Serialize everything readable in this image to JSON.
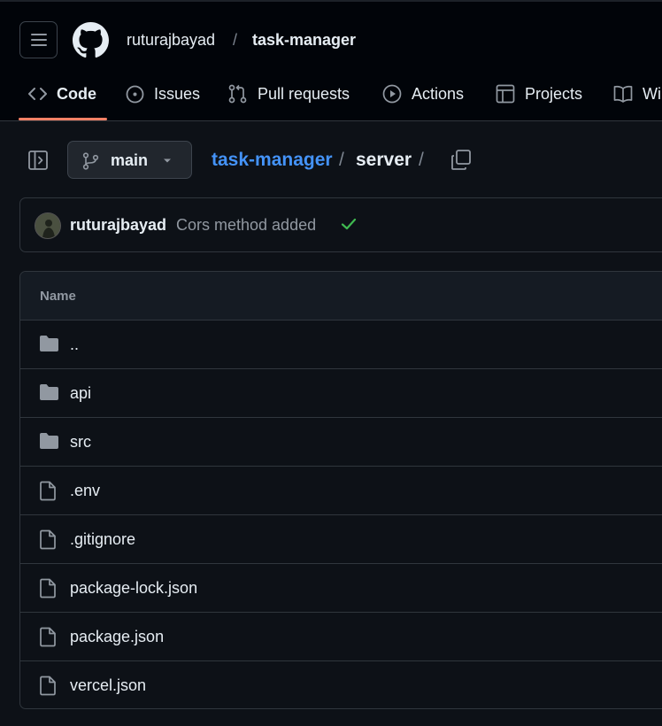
{
  "header": {
    "owner": "ruturajbayad",
    "separator": "/",
    "repo": "task-manager"
  },
  "nav": {
    "tabs": [
      {
        "label": "Code",
        "icon": "code-icon",
        "active": true
      },
      {
        "label": "Issues",
        "icon": "issue-icon",
        "active": false
      },
      {
        "label": "Pull requests",
        "icon": "pull-request-icon",
        "active": false
      },
      {
        "label": "Actions",
        "icon": "play-icon",
        "active": false
      },
      {
        "label": "Projects",
        "icon": "table-icon",
        "active": false
      },
      {
        "label": "Wi",
        "icon": "book-icon",
        "active": false
      }
    ],
    "accent": "#f78166"
  },
  "path": {
    "branch": "main",
    "repo": "task-manager",
    "sep": "/",
    "dir": "server"
  },
  "commit": {
    "author": "ruturajbayad",
    "message": "Cors method added",
    "status_color": "#3fb950"
  },
  "files": {
    "header": "Name",
    "items": [
      {
        "name": "..",
        "type": "folder"
      },
      {
        "name": "api",
        "type": "folder"
      },
      {
        "name": "src",
        "type": "folder"
      },
      {
        "name": ".env",
        "type": "file"
      },
      {
        "name": ".gitignore",
        "type": "file"
      },
      {
        "name": "package-lock.json",
        "type": "file"
      },
      {
        "name": "package.json",
        "type": "file"
      },
      {
        "name": "vercel.json",
        "type": "file"
      }
    ]
  },
  "colors": {
    "background": "#0d1117",
    "header_bg": "#010409",
    "link": "#4493f8",
    "muted": "#9198a1",
    "border": "#30363d"
  }
}
